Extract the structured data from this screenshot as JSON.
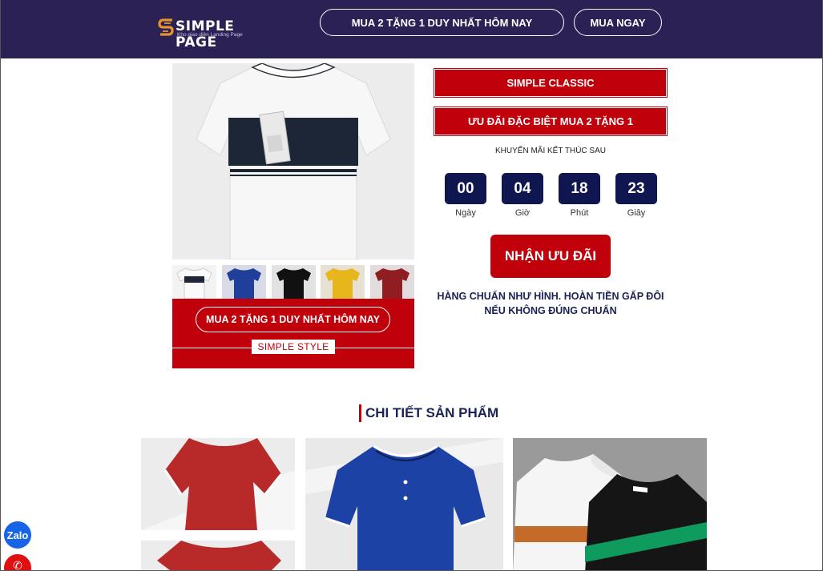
{
  "header": {
    "logo_text": "SIMPLE PAGE",
    "logo_sub": "Kho giao diện Landing Page",
    "btn_promo": "MUA 2 TẶNG 1 DUY NHẤT HÔM NAY",
    "btn_buy": "MUA NGAY"
  },
  "product": {
    "promo_pill": "MUA 2 TẶNG 1 DUY NHẤT HÔM NAY",
    "style_tag": "SIMPLE STYLE",
    "thumbnails": [
      {
        "color": "#ffffff",
        "name": "white"
      },
      {
        "color": "#1f3f9a",
        "name": "blue"
      },
      {
        "color": "#111111",
        "name": "black"
      },
      {
        "color": "#e7b51c",
        "name": "yellow"
      },
      {
        "color": "#8f1d22",
        "name": "maroon"
      }
    ]
  },
  "offer": {
    "banner1": "SIMPLE CLASSIC",
    "banner2": "ƯU ĐÃI ĐẶC BIỆT MUA 2 TẶNG 1",
    "promo_end": "KHUYẾN MÃI KẾT THÚC SAU",
    "countdown": [
      {
        "value": "00",
        "label": "Ngày"
      },
      {
        "value": "04",
        "label": "Giờ"
      },
      {
        "value": "18",
        "label": "Phút"
      },
      {
        "value": "23",
        "label": "Giây"
      }
    ],
    "cta": "NHẬN ƯU ĐÃI",
    "guarantee_line1": "HÀNG CHUẨN NHƯ HÌNH. HOÀN TIỀN GẤP ĐÔI",
    "guarantee_line2": "NẾU KHÔNG ĐÚNG CHUẨN"
  },
  "details": {
    "title": "CHI TIẾT SẢN PHẨM"
  },
  "floating": {
    "zalo": "Zalo"
  },
  "colors": {
    "header_bg": "#2b2154",
    "accent_red": "#c0000b",
    "countdown_bg": "#0f1650",
    "text_navy": "#1a2255"
  }
}
